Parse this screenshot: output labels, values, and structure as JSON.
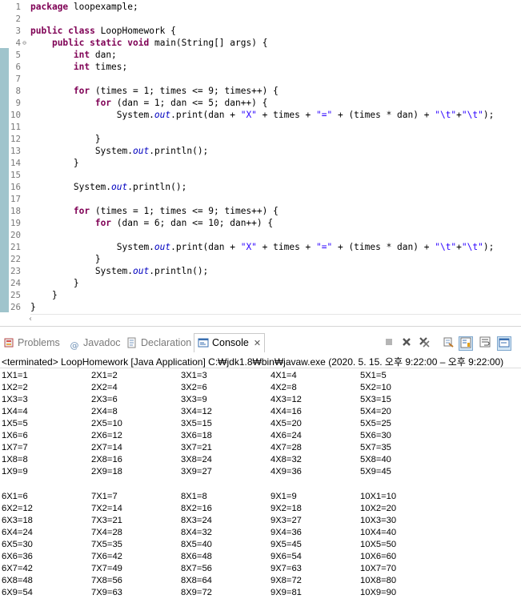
{
  "editor": {
    "lines": [
      {
        "n": "1",
        "html": "<span class=\"kw\">package</span> loopexample;"
      },
      {
        "n": "2",
        "html": ""
      },
      {
        "n": "3",
        "html": "<span class=\"kw\">public</span> <span class=\"kw\">class</span> LoopHomework {"
      },
      {
        "n": "4",
        "html": "    <span class=\"kw\">public</span> <span class=\"kw\">static</span> <span class=\"kw\">void</span> main(String[] args) {",
        "fold": true
      },
      {
        "n": "5",
        "html": "        <span class=\"kw\">int</span> dan;"
      },
      {
        "n": "6",
        "html": "        <span class=\"kw\">int</span> times;"
      },
      {
        "n": "7",
        "html": ""
      },
      {
        "n": "8",
        "html": "        <span class=\"kw\">for</span> (times = 1; times &lt;= 9; times++) {"
      },
      {
        "n": "9",
        "html": "            <span class=\"kw\">for</span> (dan = 1; dan &lt;= 5; dan++) {"
      },
      {
        "n": "10",
        "html": "                System.<span class=\"fld\">out</span>.print(dan + <span class=\"str\">\"X\"</span> + times + <span class=\"str\">\"=\"</span> + (times * dan) + <span class=\"str\">\"\\t\"</span>+<span class=\"str\">\"\\t\"</span>);"
      },
      {
        "n": "11",
        "html": ""
      },
      {
        "n": "12",
        "html": "            }"
      },
      {
        "n": "13",
        "html": "            System.<span class=\"fld\">out</span>.println();"
      },
      {
        "n": "14",
        "html": "        }"
      },
      {
        "n": "15",
        "html": ""
      },
      {
        "n": "16",
        "html": "        System.<span class=\"fld\">out</span>.println();"
      },
      {
        "n": "17",
        "html": ""
      },
      {
        "n": "18",
        "html": "        <span class=\"kw\">for</span> (times = 1; times &lt;= 9; times++) {"
      },
      {
        "n": "19",
        "html": "            <span class=\"kw\">for</span> (dan = 6; dan &lt;= 10; dan++) {"
      },
      {
        "n": "20",
        "html": ""
      },
      {
        "n": "21",
        "html": "                System.<span class=\"fld\">out</span>.print(dan + <span class=\"str\">\"X\"</span> + times + <span class=\"str\">\"=\"</span> + (times * dan) + <span class=\"str\">\"\\t\"</span>+<span class=\"str\">\"\\t\"</span>);"
      },
      {
        "n": "22",
        "html": "            }"
      },
      {
        "n": "23",
        "html": "            System.<span class=\"fld\">out</span>.println();"
      },
      {
        "n": "24",
        "html": "        }"
      },
      {
        "n": "25",
        "html": "    }"
      },
      {
        "n": "26",
        "html": "}"
      }
    ]
  },
  "tabs": [
    {
      "label": "Problems",
      "icon": "problems-icon"
    },
    {
      "label": "Javadoc",
      "icon": "javadoc-icon"
    },
    {
      "label": "Declaration",
      "icon": "declaration-icon"
    },
    {
      "label": "Console",
      "icon": "console-icon",
      "active": true
    }
  ],
  "toolbar": [
    "stop-icon",
    "remove-launch-icon",
    "remove-all-terminated-icon",
    "clear-console-icon",
    "scroll-lock-icon",
    "word-wrap-icon",
    "open-console-icon"
  ],
  "console": {
    "status": "<terminated> LoopHomework [Java Application] C:₩jdk1.8₩bin₩javaw.exe  (2020. 5. 15. 오후 9:22:00 – 오후 9:22:00)",
    "block1": [
      [
        "1X1=1",
        "2X1=2",
        "3X1=3",
        "4X1=4",
        "5X1=5"
      ],
      [
        "1X2=2",
        "2X2=4",
        "3X2=6",
        "4X2=8",
        "5X2=10"
      ],
      [
        "1X3=3",
        "2X3=6",
        "3X3=9",
        "4X3=12",
        "5X3=15"
      ],
      [
        "1X4=4",
        "2X4=8",
        "3X4=12",
        "4X4=16",
        "5X4=20"
      ],
      [
        "1X5=5",
        "2X5=10",
        "3X5=15",
        "4X5=20",
        "5X5=25"
      ],
      [
        "1X6=6",
        "2X6=12",
        "3X6=18",
        "4X6=24",
        "5X6=30"
      ],
      [
        "1X7=7",
        "2X7=14",
        "3X7=21",
        "4X7=28",
        "5X7=35"
      ],
      [
        "1X8=8",
        "2X8=16",
        "3X8=24",
        "4X8=32",
        "5X8=40"
      ],
      [
        "1X9=9",
        "2X9=18",
        "3X9=27",
        "4X9=36",
        "5X9=45"
      ]
    ],
    "block2": [
      [
        "6X1=6",
        "7X1=7",
        "8X1=8",
        "9X1=9",
        "10X1=10"
      ],
      [
        "6X2=12",
        "7X2=14",
        "8X2=16",
        "9X2=18",
        "10X2=20"
      ],
      [
        "6X3=18",
        "7X3=21",
        "8X3=24",
        "9X3=27",
        "10X3=30"
      ],
      [
        "6X4=24",
        "7X4=28",
        "8X4=32",
        "9X4=36",
        "10X4=40"
      ],
      [
        "6X5=30",
        "7X5=35",
        "8X5=40",
        "9X5=45",
        "10X5=50"
      ],
      [
        "6X6=36",
        "7X6=42",
        "8X6=48",
        "9X6=54",
        "10X6=60"
      ],
      [
        "6X7=42",
        "7X7=49",
        "8X7=56",
        "9X7=63",
        "10X7=70"
      ],
      [
        "6X8=48",
        "7X8=56",
        "8X8=64",
        "9X8=72",
        "10X8=80"
      ],
      [
        "6X9=54",
        "7X9=63",
        "8X9=72",
        "9X9=81",
        "10X9=90"
      ]
    ]
  }
}
